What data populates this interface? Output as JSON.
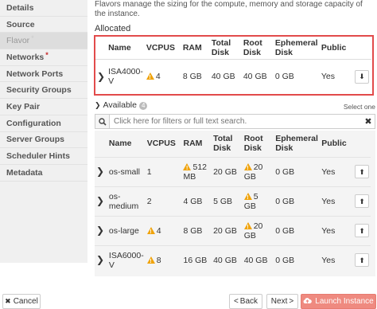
{
  "sidebar": {
    "items": [
      {
        "label": "Details",
        "required": false,
        "active": false
      },
      {
        "label": "Source",
        "required": false,
        "active": false
      },
      {
        "label": "Flavor",
        "required": true,
        "active": true
      },
      {
        "label": "Networks",
        "required": true,
        "active": false
      },
      {
        "label": "Network Ports",
        "required": false,
        "active": false
      },
      {
        "label": "Security Groups",
        "required": false,
        "active": false
      },
      {
        "label": "Key Pair",
        "required": false,
        "active": false
      },
      {
        "label": "Configuration",
        "required": false,
        "active": false
      },
      {
        "label": "Server Groups",
        "required": false,
        "active": false
      },
      {
        "label": "Scheduler Hints",
        "required": false,
        "active": false
      },
      {
        "label": "Metadata",
        "required": false,
        "active": false
      }
    ]
  },
  "main": {
    "description": "Flavors manage the sizing for the compute, memory and storage capacity of the instance.",
    "allocated_title": "Allocated",
    "columns": {
      "name": "Name",
      "vcpus": "VCPUS",
      "ram": "RAM",
      "total_disk": "Total Disk",
      "root_disk": "Root Disk",
      "ephemeral_disk": "Ephemeral Disk",
      "public": "Public"
    },
    "allocated": [
      {
        "name": "ISA4000-V",
        "vcpus": "4",
        "vcpus_warn": true,
        "ram": "8 GB",
        "ram_warn": false,
        "total_disk": "40 GB",
        "root_disk": "40 GB",
        "root_warn": false,
        "ephemeral": "0 GB",
        "public": "Yes"
      }
    ],
    "available_title": "Available",
    "available_count": "4",
    "select_one": "Select one",
    "search_placeholder": "Click here for filters or full text search.",
    "available": [
      {
        "name": "os-small",
        "vcpus": "1",
        "vcpus_warn": false,
        "ram": "512 MB",
        "ram_warn": true,
        "total_disk": "20 GB",
        "root_disk": "20 GB",
        "root_warn": true,
        "ephemeral": "0 GB",
        "public": "Yes"
      },
      {
        "name": "os-medium",
        "vcpus": "2",
        "vcpus_warn": false,
        "ram": "4 GB",
        "ram_warn": false,
        "total_disk": "5 GB",
        "root_disk": "5 GB",
        "root_warn": true,
        "ephemeral": "0 GB",
        "public": "Yes"
      },
      {
        "name": "os-large",
        "vcpus": "4",
        "vcpus_warn": true,
        "ram": "8 GB",
        "ram_warn": false,
        "total_disk": "20 GB",
        "root_disk": "20 GB",
        "root_warn": true,
        "ephemeral": "0 GB",
        "public": "Yes"
      },
      {
        "name": "ISA6000-V",
        "vcpus": "8",
        "vcpus_warn": true,
        "ram": "16 GB",
        "ram_warn": false,
        "total_disk": "40 GB",
        "root_disk": "40 GB",
        "root_warn": false,
        "ephemeral": "0 GB",
        "public": "Yes"
      }
    ]
  },
  "footer": {
    "cancel": "Cancel",
    "back": "Back",
    "next": "Next",
    "launch": "Launch Instance"
  },
  "icons": {
    "warning": "warning-icon",
    "expand": "chevron-right-icon",
    "remove": "arrow-down-icon",
    "add": "arrow-up-icon",
    "search": "search-icon",
    "clear": "close-icon"
  },
  "colors": {
    "highlight_border": "#e24b4b",
    "warning": "#f0a30a",
    "launch_button": "#ef8a80",
    "required_star": "#c62828"
  }
}
